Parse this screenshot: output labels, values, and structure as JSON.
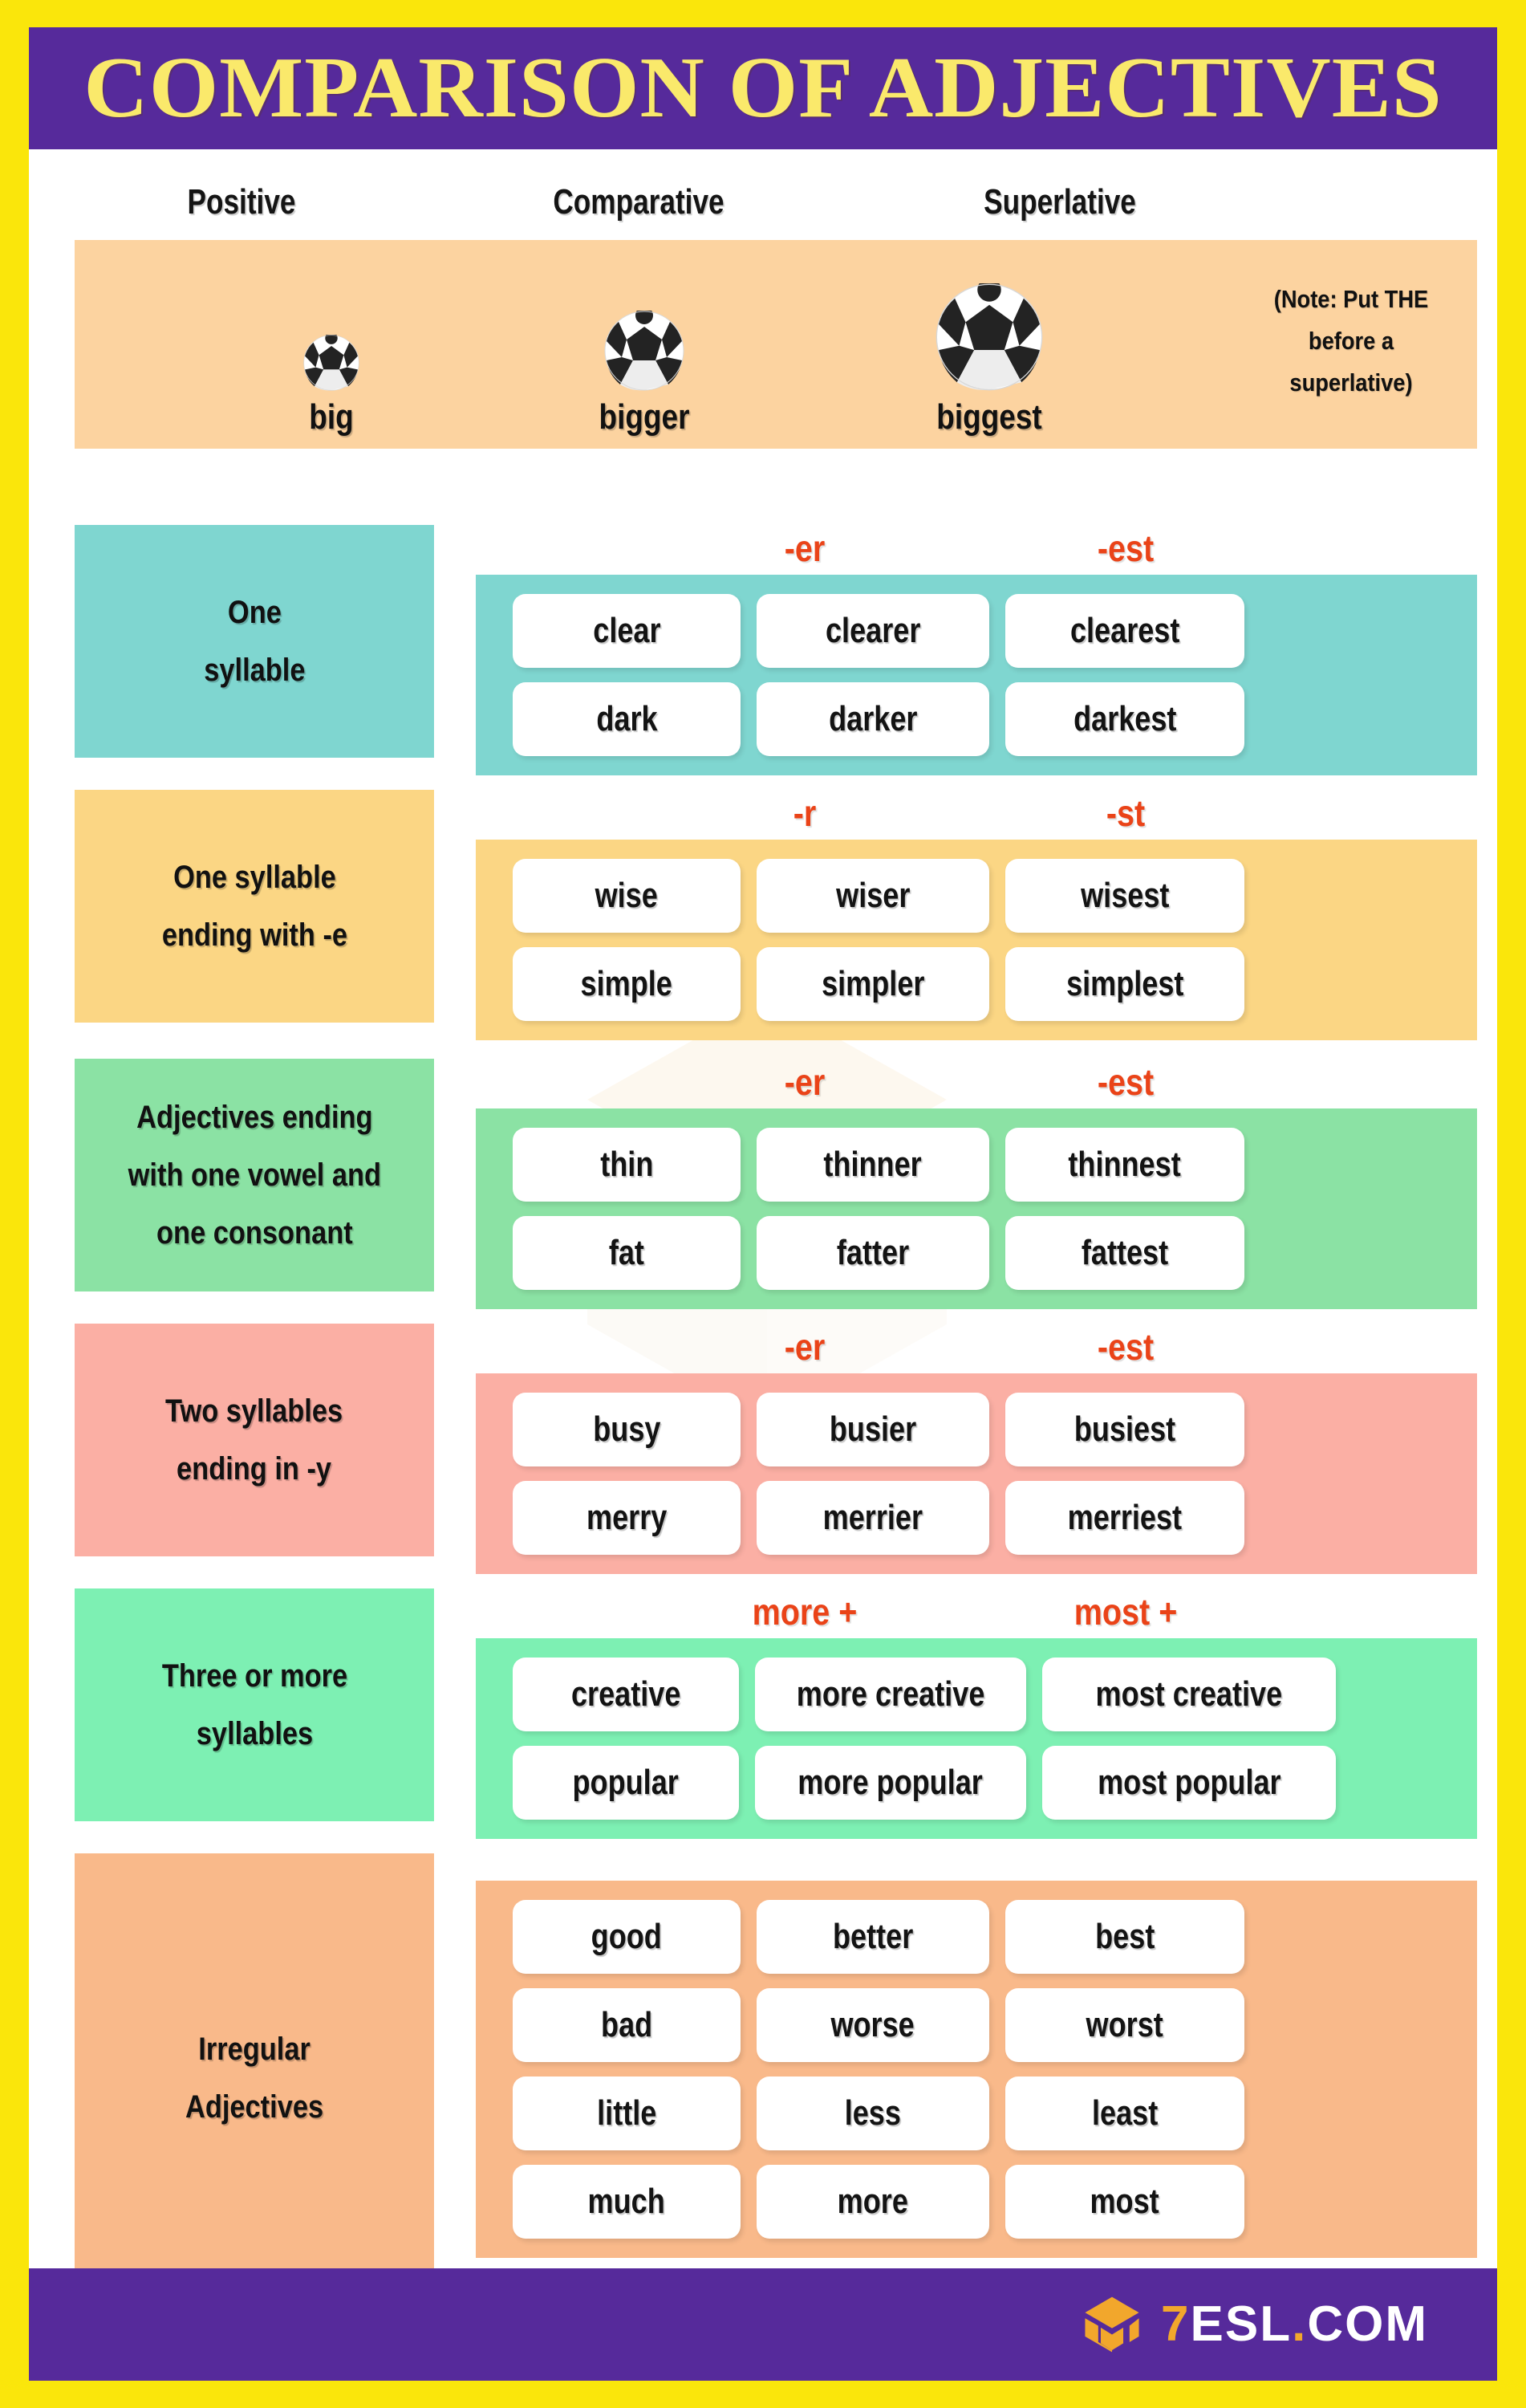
{
  "title": "COMPARISON OF ADJECTIVES",
  "columns": [
    "Positive",
    "Comparative",
    "Superlative"
  ],
  "example": {
    "note": "(Note: Put THE before a superlative)",
    "items": [
      {
        "label": "big",
        "ball_size": 70
      },
      {
        "label": "bigger",
        "ball_size": 100
      },
      {
        "label": "biggest",
        "ball_size": 134
      }
    ]
  },
  "sections": [
    {
      "label": "One\nsyllable",
      "color": "#7FD6D0",
      "suffix_comparative": "-er",
      "suffix_superlative": "-est",
      "width": "narrow",
      "rows": [
        [
          "clear",
          "clearer",
          "clearest"
        ],
        [
          "dark",
          "darker",
          "darkest"
        ]
      ]
    },
    {
      "label": "One syllable\nending with -e",
      "color": "#FBD684",
      "suffix_comparative": "-r",
      "suffix_superlative": "-st",
      "width": "narrow",
      "rows": [
        [
          "wise",
          "wiser",
          "wisest"
        ],
        [
          "simple",
          "simpler",
          "simplest"
        ]
      ]
    },
    {
      "label": "Adjectives ending\nwith one vowel and\none consonant",
      "color": "#8BE2A4",
      "suffix_comparative": "-er",
      "suffix_superlative": "-est",
      "width": "narrow",
      "rows": [
        [
          "thin",
          "thinner",
          "thinnest"
        ],
        [
          "fat",
          "fatter",
          "fattest"
        ]
      ]
    },
    {
      "label": "Two syllables\nending in -y",
      "color": "#FBAFA4",
      "suffix_comparative": "-er",
      "suffix_superlative": "-est",
      "width": "narrow",
      "rows": [
        [
          "busy",
          "busier",
          "busiest"
        ],
        [
          "merry",
          "merrier",
          "merriest"
        ]
      ]
    },
    {
      "label": "Three or more\nsyllables",
      "color": "#7DF0B3",
      "suffix_comparative": "more +",
      "suffix_superlative": "most +",
      "width": "wide",
      "rows": [
        [
          "creative",
          "more creative",
          "most creative"
        ],
        [
          "popular",
          "more popular",
          "most popular"
        ]
      ]
    },
    {
      "label": "Irregular\nAdjectives",
      "color": "#F9B98A",
      "suffix_comparative": "",
      "suffix_superlative": "",
      "width": "narrow",
      "rows": [
        [
          "good",
          "better",
          "best"
        ],
        [
          "bad",
          "worse",
          "worst"
        ],
        [
          "little",
          "less",
          "least"
        ],
        [
          "much",
          "more",
          "most"
        ]
      ]
    }
  ],
  "footer": {
    "logo_icon": "cube-logo-icon",
    "logo_seven": "7",
    "logo_esl": "ESL",
    "logo_dot": ".",
    "logo_com": "COM"
  },
  "colors": {
    "page_border": "#FAE60B",
    "header_bar": "#562A9B",
    "title_text": "#FAE96B",
    "suffix_text": "#EA4318",
    "example_band": "#FCD3A0",
    "logo_accent": "#F2A72C"
  }
}
